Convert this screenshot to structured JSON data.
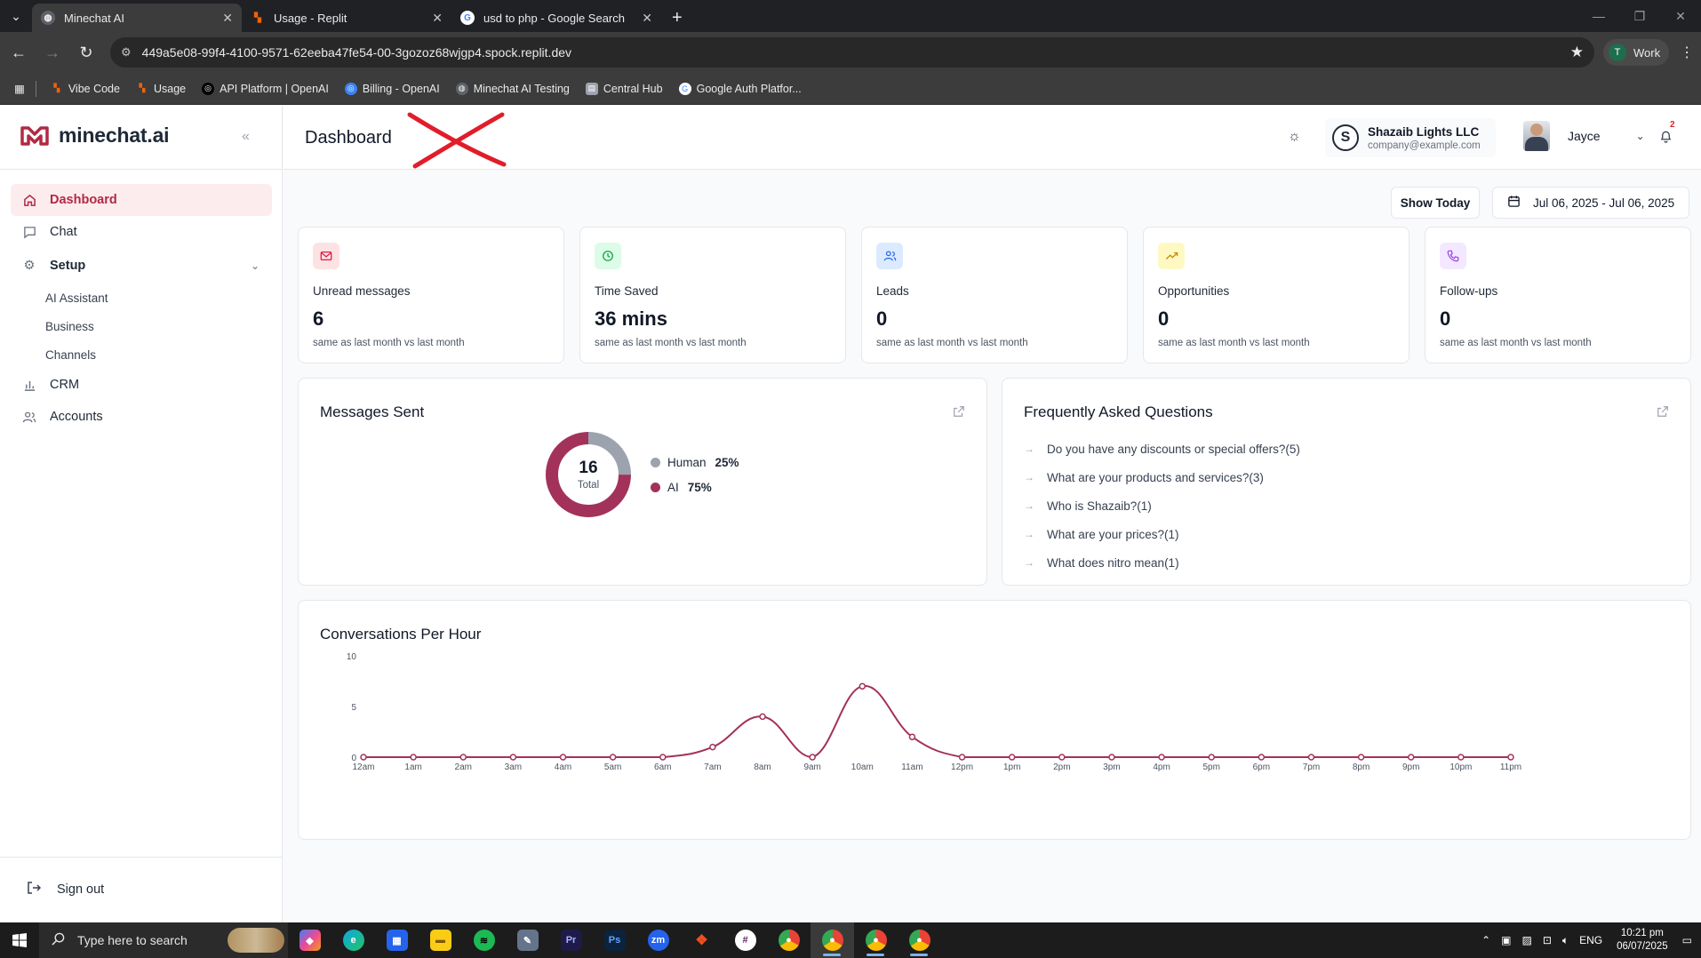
{
  "browser": {
    "tabs": [
      {
        "title": "Minechat AI",
        "active": true
      },
      {
        "title": "Usage - Replit",
        "active": false
      },
      {
        "title": "usd to php - Google Search",
        "active": false
      }
    ],
    "url": "449a5e08-99f4-4100-9571-62eeba47fe54-00-3gozoz68wjgp4.spock.replit.dev",
    "profile_initial": "T",
    "profile_label": "Work",
    "bookmarks": [
      "Vibe Code",
      "Usage",
      "API Platform | OpenAI",
      "Billing - OpenAI",
      "Minechat AI Testing",
      "Central Hub",
      "Google Auth Platfor..."
    ]
  },
  "app": {
    "brand": "minechat.ai",
    "brand_color": "#b02a44",
    "nav": {
      "dashboard": "Dashboard",
      "chat": "Chat",
      "setup": "Setup",
      "setup_items": [
        "AI Assistant",
        "Business",
        "Channels"
      ],
      "crm": "CRM",
      "accounts": "Accounts"
    },
    "signout": "Sign out"
  },
  "header": {
    "title": "Dashboard",
    "company_initial": "S",
    "company_name": "Shazaib Lights LLC",
    "company_email": "company@example.com",
    "user_name": "Jayce",
    "notification_count": "2"
  },
  "toolbar": {
    "today_label": "Show Today",
    "date_range": "Jul 06, 2025 - Jul 06, 2025"
  },
  "stats": [
    {
      "label": "Unread messages",
      "value": "6",
      "note": "same as last month vs last month",
      "icon": "mail-icon",
      "bg": "#fde2e4",
      "fg": "#e11d48"
    },
    {
      "label": "Time Saved",
      "value": "36 mins",
      "note": "same as last month vs last month",
      "icon": "clock-icon",
      "bg": "#dcfce7",
      "fg": "#16a34a"
    },
    {
      "label": "Leads",
      "value": "0",
      "note": "same as last month vs last month",
      "icon": "users-icon",
      "bg": "#dbeafe",
      "fg": "#2563eb"
    },
    {
      "label": "Opportunities",
      "value": "0",
      "note": "same as last month vs last month",
      "icon": "trending-up-icon",
      "bg": "#fef9c3",
      "fg": "#ca8a04"
    },
    {
      "label": "Follow-ups",
      "value": "0",
      "note": "same as last month vs last month",
      "icon": "phone-icon",
      "bg": "#f3e8ff",
      "fg": "#9333ea"
    }
  ],
  "messages_sent": {
    "title": "Messages Sent",
    "total": "16",
    "total_label": "Total",
    "legend": [
      {
        "name": "Human",
        "pct": "25%",
        "color": "#9ca3af"
      },
      {
        "name": "AI",
        "pct": "75%",
        "color": "#a3325a"
      }
    ]
  },
  "faq": {
    "title": "Frequently Asked Questions",
    "items": [
      "Do you have any discounts or special offers?(5)",
      "What are your products and services?(3)",
      "Who is Shazaib?(1)",
      "What are your prices?(1)",
      "What does nitro mean(1)"
    ]
  },
  "chart_data": {
    "type": "line",
    "title": "Conversations Per Hour",
    "x": [
      "12am",
      "1am",
      "2am",
      "3am",
      "4am",
      "5am",
      "6am",
      "7am",
      "8am",
      "9am",
      "10am",
      "11am",
      "12pm",
      "1pm",
      "2pm",
      "3pm",
      "4pm",
      "5pm",
      "6pm",
      "7pm",
      "8pm",
      "9pm",
      "10pm",
      "11pm"
    ],
    "series": [
      {
        "values": [
          0,
          0,
          0,
          0,
          0,
          0,
          0,
          1,
          4,
          0,
          7,
          2,
          0,
          0,
          0,
          0,
          0,
          0,
          0,
          0,
          0,
          0,
          0,
          0
        ],
        "color": "#a3325a"
      }
    ],
    "yticks": [
      "0",
      "5",
      "10"
    ],
    "ylim": [
      0,
      10
    ]
  },
  "taskbar": {
    "search_placeholder": "Type here to search",
    "lang": "ENG",
    "time": "10:21 pm",
    "date": "06/07/2025"
  }
}
